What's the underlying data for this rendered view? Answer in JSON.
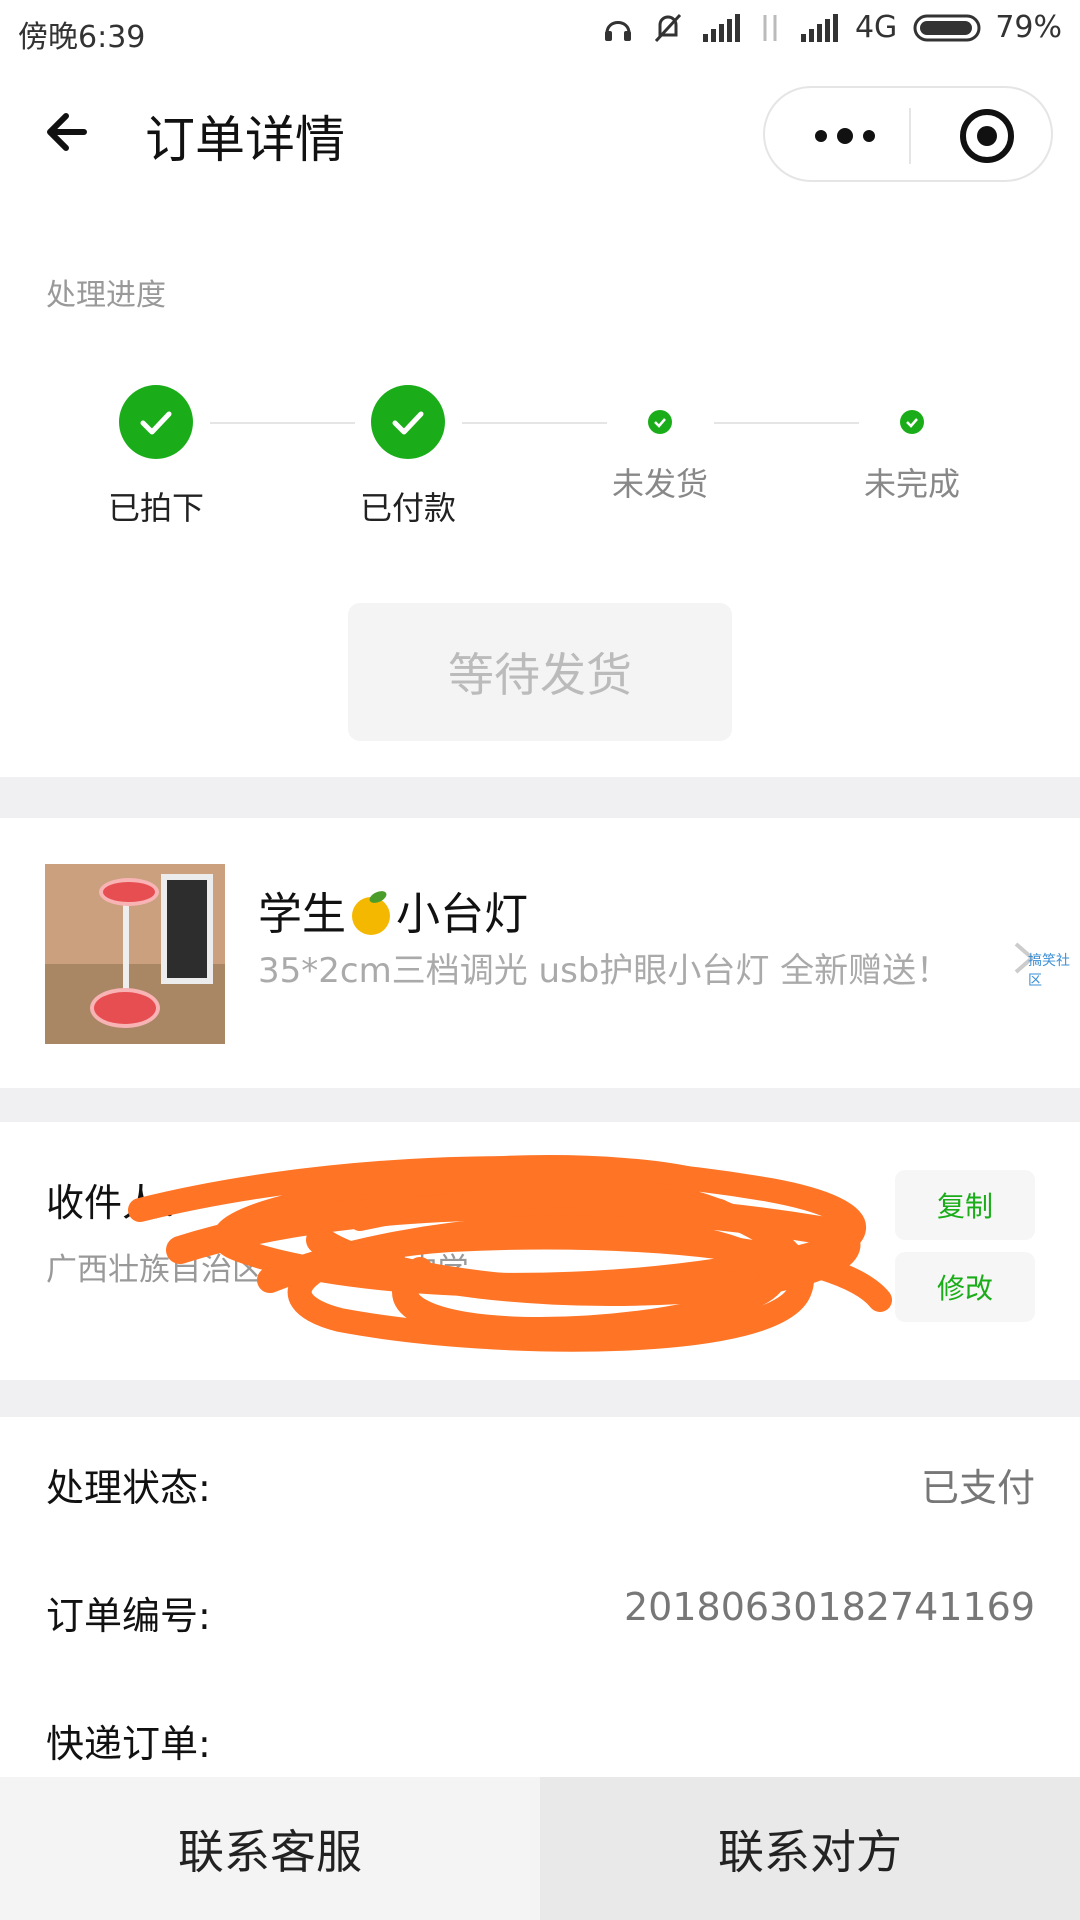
{
  "status_bar": {
    "time": "傍晚6:39",
    "network": "4G",
    "battery": "79%"
  },
  "header": {
    "title": "订单详情"
  },
  "progress": {
    "label": "处理进度",
    "steps": [
      {
        "label": "已拍下"
      },
      {
        "label": "已付款"
      },
      {
        "label": "未发货"
      },
      {
        "label": "未完成"
      }
    ],
    "status_button": "等待发货"
  },
  "product": {
    "title_prefix": "学生",
    "title_suffix": "小台灯",
    "description": "35*2cm三档调光 usb护眼小台灯 全新赠送！",
    "watermark": "搞笑社区"
  },
  "address": {
    "name_line": "收件人：",
    "address_line": "广西壮族自治区 县,平南镇中学",
    "copy_label": "复制",
    "edit_label": "修改"
  },
  "info": {
    "status_key": "处理状态:",
    "status_value": "已支付",
    "order_key": "订单编号:",
    "order_value": "20180630182741169",
    "express_key": "快递订单:"
  },
  "bottom_bar": {
    "contact_service": "联系客服",
    "contact_other": "联系对方"
  }
}
